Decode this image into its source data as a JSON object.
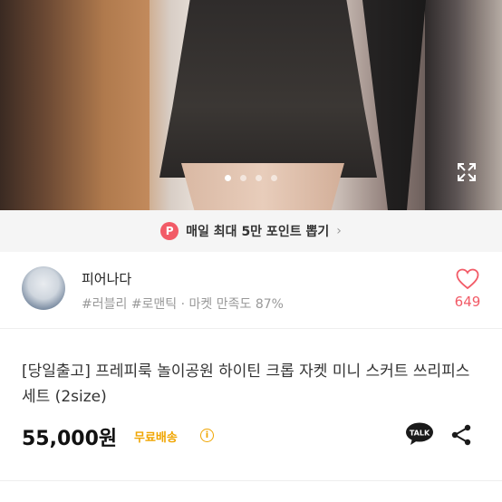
{
  "hero": {
    "image_description_icon": "product-photo",
    "dots_count_icon": "carousel-dots",
    "expand_icon": "expand-icon"
  },
  "promo": {
    "badge": "P",
    "text": "매일 최대 5만 포인트 뽑기",
    "chevron": "›"
  },
  "shop": {
    "name": "피어나다",
    "tags": "#러블리 #로맨틱 · 마켓 만족도 87%",
    "like_count": "649"
  },
  "product": {
    "title": "[당일출고] 프레피룩 놀이공원 하이틴 크롭 자켓 미니 스커트 쓰리피스 세트 (2size)",
    "price": "55,000원",
    "shipping": "무료배송",
    "info": "i"
  },
  "talk": {
    "label": "TALK"
  },
  "colors": {
    "accent": "#f25b67",
    "shipping": "#f0a500"
  }
}
